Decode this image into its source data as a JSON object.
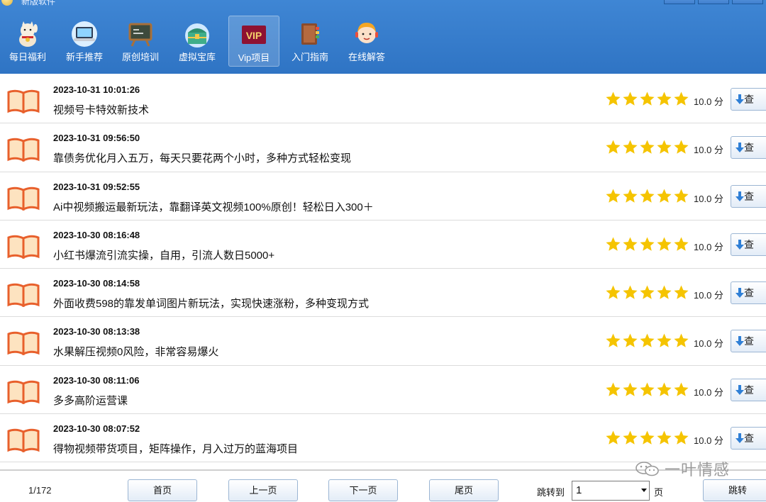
{
  "window": {
    "title": "新版软件"
  },
  "nav": {
    "items": [
      {
        "label": "每日福利",
        "icon": "lucky-cat-icon"
      },
      {
        "label": "新手推荐",
        "icon": "laptop-icon"
      },
      {
        "label": "原创培训",
        "icon": "blackboard-icon"
      },
      {
        "label": "虚拟宝库",
        "icon": "treasure-chest-icon"
      },
      {
        "label": "Vip项目",
        "icon": "vip-badge-icon",
        "badge": "VIP",
        "active": true
      },
      {
        "label": "入门指南",
        "icon": "guide-book-icon"
      },
      {
        "label": "在线解答",
        "icon": "customer-service-icon"
      }
    ]
  },
  "list": {
    "rows": [
      {
        "date": "2023-10-31 10:01:26",
        "title": "视频号卡特效新技术",
        "score": "10.0 分",
        "button": "查"
      },
      {
        "date": "2023-10-31 09:56:50",
        "title": "靠债务优化月入五万，每天只要花两个小时，多种方式轻松变现",
        "score": "10.0 分",
        "button": "查"
      },
      {
        "date": "2023-10-31 09:52:55",
        "title": "Ai中视频搬运最新玩法，靠翻译英文视频100%原创！轻松日入300＋",
        "score": "10.0 分",
        "button": "查"
      },
      {
        "date": "2023-10-30 08:16:48",
        "title": "小红书爆流引流实操，自用，引流人数日5000+",
        "score": "10.0 分",
        "button": "查"
      },
      {
        "date": "2023-10-30 08:14:58",
        "title": "外面收费598的靠发单词图片新玩法，实现快速涨粉，多种变现方式",
        "score": "10.0 分",
        "button": "查"
      },
      {
        "date": "2023-10-30 08:13:38",
        "title": "水果解压视频0风险，非常容易爆火",
        "score": "10.0 分",
        "button": "查"
      },
      {
        "date": "2023-10-30 08:11:06",
        "title": "多多高阶运营课",
        "score": "10.0 分",
        "button": "查"
      },
      {
        "date": "2023-10-30 08:07:52",
        "title": "得物视频带货项目，矩阵操作，月入过万的蓝海项目",
        "score": "10.0 分",
        "button": "查"
      }
    ],
    "rating_stars": 5
  },
  "footer": {
    "page_indicator": "1/172",
    "first": "首页",
    "prev": "上一页",
    "next": "下一页",
    "last": "尾页",
    "jump_label": "跳转到",
    "jump_value": "1",
    "page_unit": "页",
    "jump_button": "跳转"
  },
  "watermark": {
    "text": "一叶情感",
    "icon": "wechat-icon"
  },
  "colors": {
    "header": "#3a7fce",
    "star": "#f5c400",
    "book_orange": "#e8602c"
  }
}
